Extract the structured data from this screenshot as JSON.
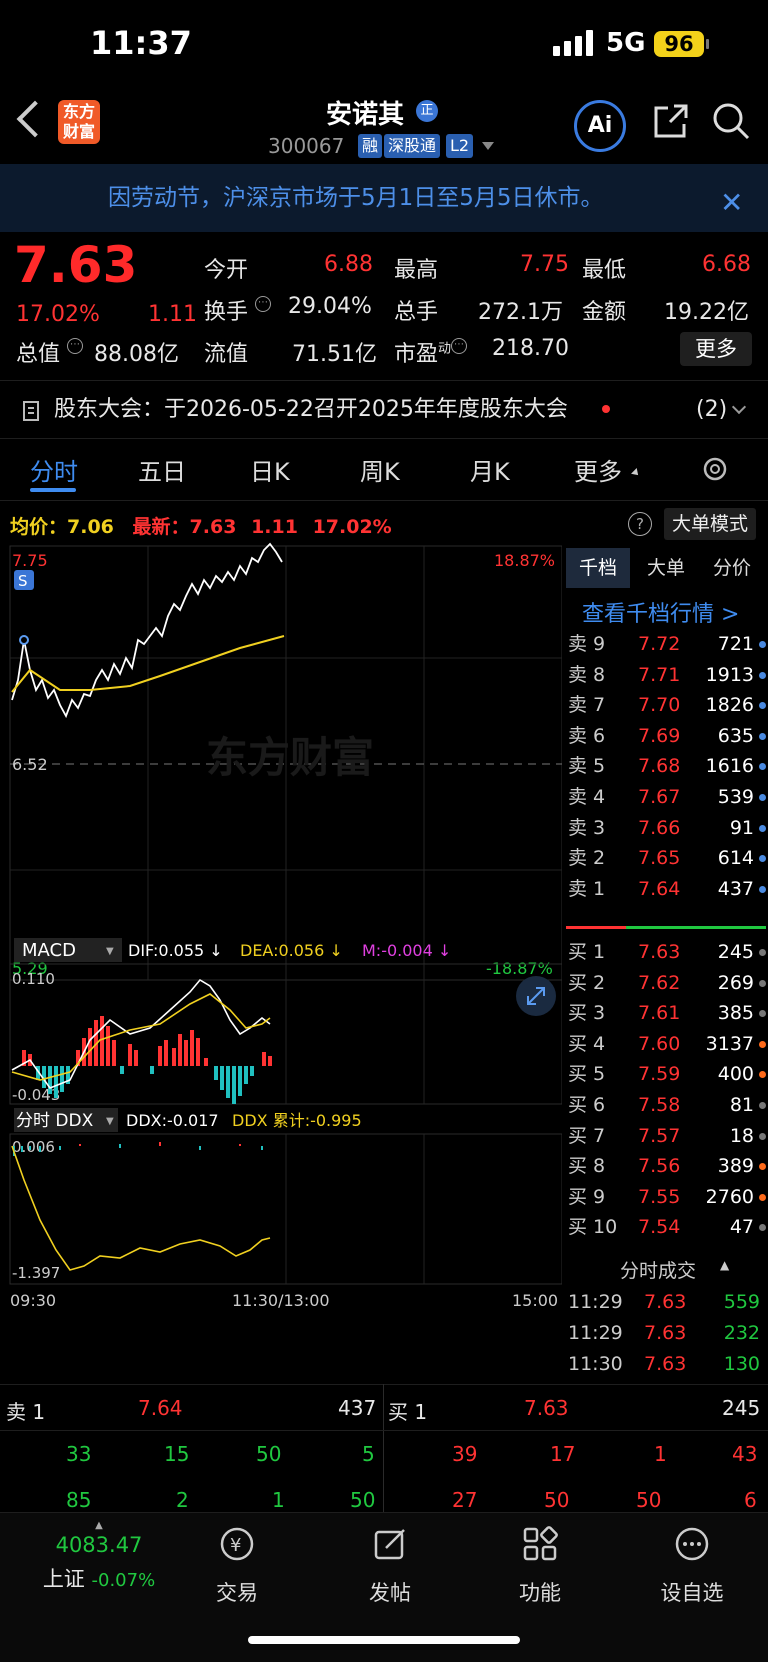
{
  "status": {
    "time": "11:37",
    "network": "5G",
    "battery": "96"
  },
  "header": {
    "logo_line1": "东方",
    "logo_line2": "财富",
    "name": "安诺其",
    "name_badge": "正",
    "code": "300067",
    "tag1": "融",
    "tag2": "深股通",
    "tag3": "L2",
    "ai_label": "Ai"
  },
  "notice": "因劳动节，沪深京市场于5月1日至5月5日休市。",
  "quote": {
    "price": "7.63",
    "pct": "17.02%",
    "change": "1.11",
    "open_label": "今开",
    "open": "6.88",
    "high_label": "最高",
    "high": "7.75",
    "low_label": "最低",
    "low": "6.68",
    "turnover_label": "换手",
    "turnover": "29.04%",
    "volume_label": "总手",
    "volume": "272.1万",
    "amount_label": "金额",
    "amount": "19.22亿",
    "mcap_label": "总值",
    "mcap": "88.08亿",
    "float_label": "流值",
    "float": "71.51亿",
    "pe_label": "市盈",
    "pe_sup": "动",
    "pe": "218.70",
    "more": "更多"
  },
  "meeting": {
    "text": "股东大会：于2026-05-22召开2025年年度股东大会",
    "count": "(2)"
  },
  "tabs": [
    "分时",
    "五日",
    "日K",
    "周K",
    "月K",
    "更多"
  ],
  "chart": {
    "avg_label": "均价：",
    "avg": "7.06",
    "latest_label": "最新：",
    "latest": "7.63",
    "latest_chg": "1.11",
    "latest_pct": "17.02%",
    "big_mode": "大单模式",
    "y_top": "7.75",
    "y_mid": "6.52",
    "y_bot": "5.29",
    "pct_top": "18.87%",
    "pct_bot": "-18.87%",
    "watermark": "东方财富",
    "macd_label": "MACD",
    "dif": "DIF:0.055 ↓",
    "dea": "DEA:0.056 ↓",
    "m": "M:-0.004 ↓",
    "macd_top": "0.110",
    "macd_bot": "-0.043",
    "ddx_label": "分时 DDX",
    "ddx": "DDX:-0.017",
    "ddx_sum": "DDX 累计:-0.995",
    "ddx_top": "0.006",
    "ddx_bot": "-1.397",
    "t_start": "09:30",
    "t_mid": "11:30/13:00",
    "t_end": "15:00"
  },
  "right_panel": {
    "tabs": [
      "千档",
      "大单",
      "分价"
    ],
    "link": "查看千档行情 >",
    "asks": [
      {
        "label": "卖 9",
        "price": "7.72",
        "vol": "721"
      },
      {
        "label": "卖 8",
        "price": "7.71",
        "vol": "1913"
      },
      {
        "label": "卖 7",
        "price": "7.70",
        "vol": "1826"
      },
      {
        "label": "卖 6",
        "price": "7.69",
        "vol": "635"
      },
      {
        "label": "卖 5",
        "price": "7.68",
        "vol": "1616"
      },
      {
        "label": "卖 4",
        "price": "7.67",
        "vol": "539"
      },
      {
        "label": "卖 3",
        "price": "7.66",
        "vol": "91"
      },
      {
        "label": "卖 2",
        "price": "7.65",
        "vol": "614"
      },
      {
        "label": "卖 1",
        "price": "7.64",
        "vol": "437"
      }
    ],
    "bids": [
      {
        "label": "买 1",
        "price": "7.63",
        "vol": "245"
      },
      {
        "label": "买 2",
        "price": "7.62",
        "vol": "269"
      },
      {
        "label": "买 3",
        "price": "7.61",
        "vol": "385"
      },
      {
        "label": "买 4",
        "price": "7.60",
        "vol": "3137"
      },
      {
        "label": "买 5",
        "price": "7.59",
        "vol": "400"
      },
      {
        "label": "买 6",
        "price": "7.58",
        "vol": "81"
      },
      {
        "label": "买 7",
        "price": "7.57",
        "vol": "18"
      },
      {
        "label": "买 8",
        "price": "7.56",
        "vol": "389"
      },
      {
        "label": "买 9",
        "price": "7.55",
        "vol": "2760"
      },
      {
        "label": "买 10",
        "price": "7.54",
        "vol": "47"
      }
    ],
    "trades_title": "分时成交",
    "trades": [
      {
        "time": "11:29",
        "price": "7.63",
        "vol": "559"
      },
      {
        "time": "11:29",
        "price": "7.63",
        "vol": "232"
      },
      {
        "time": "11:30",
        "price": "7.63",
        "vol": "130"
      }
    ]
  },
  "bottom_book": {
    "sell_label": "卖 1",
    "sell_price": "7.64",
    "sell_vol": "437",
    "buy_label": "买 1",
    "buy_price": "7.63",
    "buy_vol": "245",
    "sell_row1": [
      "33",
      "15",
      "50",
      "5"
    ],
    "sell_row2": [
      "85",
      "2",
      "1",
      "50"
    ],
    "buy_row1": [
      "39",
      "17",
      "1",
      "43"
    ],
    "buy_row2": [
      "27",
      "50",
      "50",
      "6"
    ]
  },
  "nav": {
    "index_value": "4083.47",
    "index_name": "上证",
    "index_chg": "-0.07%",
    "items": [
      "交易",
      "发帖",
      "功能",
      "设自选"
    ]
  },
  "colors": {
    "up": "#ff3333",
    "down": "#20c840",
    "accent": "#3f8cf0",
    "avg_line": "#f0d020"
  }
}
